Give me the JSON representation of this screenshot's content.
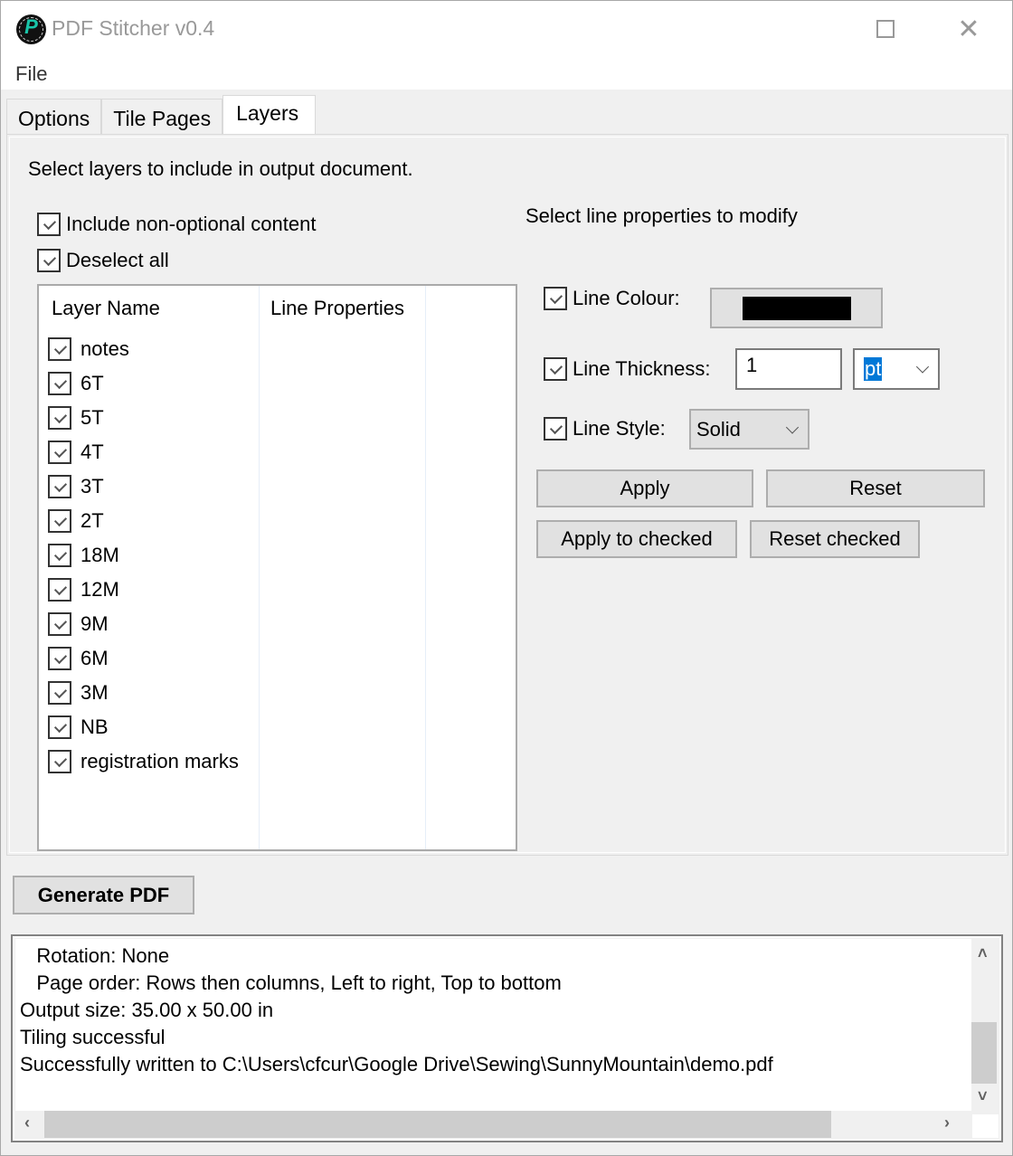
{
  "window": {
    "title": "PDF Stitcher v0.4",
    "logo_letter": "P",
    "maximize_icon": "maximize-icon",
    "close_glyph": "✕"
  },
  "menu": {
    "file": "File"
  },
  "tabs": [
    {
      "label": "Options",
      "active": false
    },
    {
      "label": "Tile Pages",
      "active": false
    },
    {
      "label": "Layers",
      "active": true
    }
  ],
  "layers_tab": {
    "instructions": "Select layers to include in output document.",
    "include_non_optional": {
      "label": "Include non-optional content",
      "checked": true
    },
    "deselect_all": {
      "label": "Deselect all",
      "checked": true
    },
    "columns": [
      "Layer Name",
      "Line Properties",
      ""
    ],
    "layers": [
      {
        "name": "notes",
        "checked": true
      },
      {
        "name": "6T",
        "checked": true
      },
      {
        "name": "5T",
        "checked": true
      },
      {
        "name": "4T",
        "checked": true
      },
      {
        "name": "3T",
        "checked": true
      },
      {
        "name": "2T",
        "checked": true
      },
      {
        "name": "18M",
        "checked": true
      },
      {
        "name": "12M",
        "checked": true
      },
      {
        "name": "9M",
        "checked": true
      },
      {
        "name": "6M",
        "checked": true
      },
      {
        "name": "3M",
        "checked": true
      },
      {
        "name": "NB",
        "checked": true
      },
      {
        "name": "registration marks",
        "checked": true
      }
    ],
    "line_props": {
      "heading": "Select line properties to modify",
      "colour": {
        "label": "Line Colour:",
        "checked": true,
        "value": "#000000"
      },
      "thickness": {
        "label": "Line Thickness:",
        "checked": true,
        "value": "1",
        "unit": "pt"
      },
      "style": {
        "label": "Line Style:",
        "checked": true,
        "value": "Solid"
      },
      "apply": "Apply",
      "reset": "Reset",
      "apply_checked": "Apply to checked",
      "reset_checked": "Reset checked"
    }
  },
  "generate_button": "Generate PDF",
  "log": {
    "lines": [
      "   Rotation: None",
      "   Page order: Rows then columns, Left to right, Top to bottom",
      "Output size: 35.00 x 50.00 in",
      "Tiling successful",
      "Successfully written to C:\\Users\\cfcur\\Google Drive\\Sewing\\SunnyMountain\\demo.pdf"
    ]
  }
}
